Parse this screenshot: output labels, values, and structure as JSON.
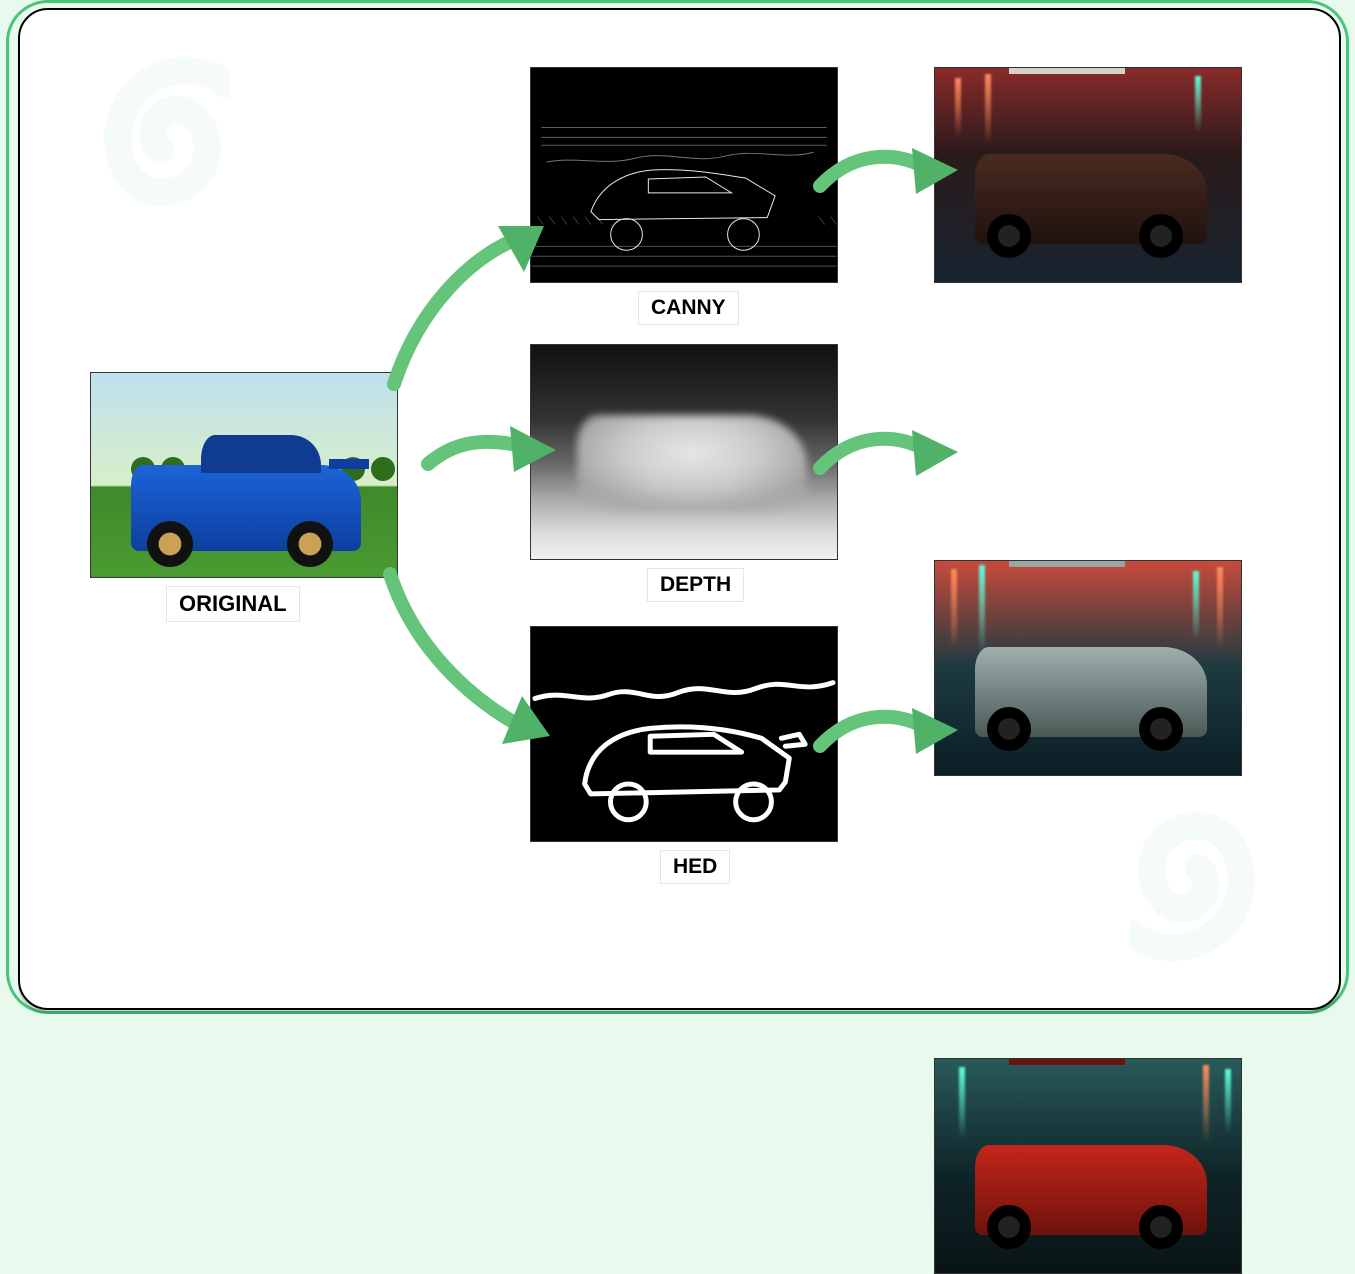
{
  "labels": {
    "original": "ORIGINAL",
    "canny": "CANNY",
    "depth": "DEPTH",
    "hed": "HED"
  },
  "tiles": {
    "original": {
      "subject": "blue sports sedan",
      "setting": "green field, daytime"
    },
    "canny": {
      "description": "Canny edge map of the original"
    },
    "depth": {
      "description": "Grayscale depth map of the original"
    },
    "hed": {
      "description": "HED edge map (thick white lines on black)"
    },
    "gen_from_canny": {
      "description": "stylized brown sedan, night city"
    },
    "gen_from_depth": {
      "description": "retro-futuristic car, neon city"
    },
    "gen_from_hed": {
      "description": "red sedan, neon night city"
    }
  },
  "arrows": {
    "a1": {
      "from": "original",
      "to": "canny"
    },
    "a2": {
      "from": "original",
      "to": "depth"
    },
    "a3": {
      "from": "original",
      "to": "hed"
    },
    "a4": {
      "from": "canny",
      "to": "gen_from_canny"
    },
    "a5": {
      "from": "depth",
      "to": "gen_from_depth"
    },
    "a6": {
      "from": "hed",
      "to": "gen_from_hed"
    }
  },
  "colors": {
    "accent": "#63c47a",
    "arrow_head": "#4fb268"
  }
}
